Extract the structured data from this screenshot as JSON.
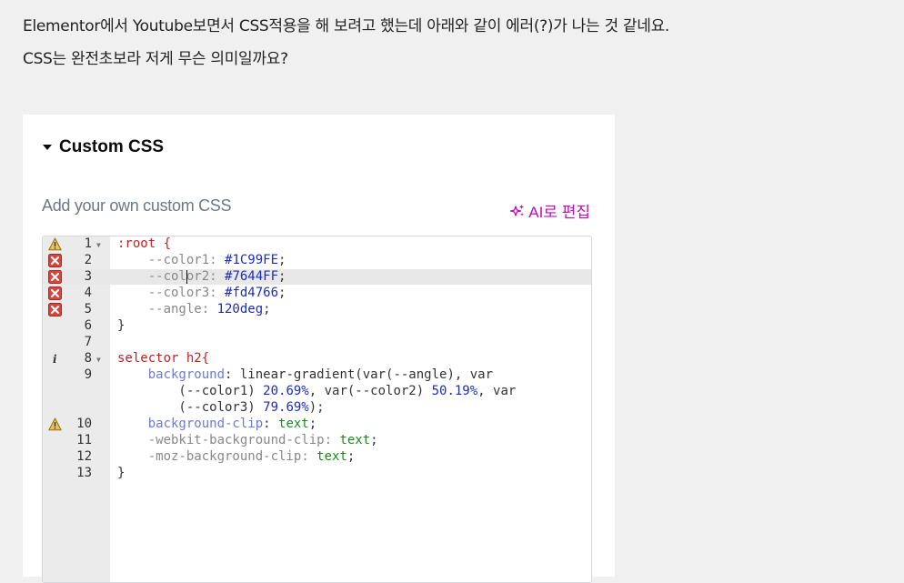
{
  "question": {
    "line1": "Elementor에서 Youtube보면서 CSS적용을 해 보려고 했는데 아래와 같이 에러(?)가 나는 것 같네요.",
    "line2": "CSS는 완전초보라 저게 무슨 의미일까요?"
  },
  "panel": {
    "section_title": "Custom CSS",
    "description": "Add your own custom CSS",
    "ai_button_label": "AI로 편집",
    "ai_icon": "sparkle-icon"
  },
  "editor": {
    "active_line": 3,
    "lines": [
      {
        "n": "1",
        "fold": true,
        "marker": "warning"
      },
      {
        "n": "2",
        "marker": "error"
      },
      {
        "n": "3",
        "marker": "error"
      },
      {
        "n": "4",
        "marker": "error"
      },
      {
        "n": "5",
        "marker": "error"
      },
      {
        "n": "6"
      },
      {
        "n": "7"
      },
      {
        "n": "8",
        "fold": true,
        "marker": "info"
      },
      {
        "n": "9"
      },
      {
        "n": ""
      },
      {
        "n": ""
      },
      {
        "n": "10",
        "marker": "warning"
      },
      {
        "n": "11"
      },
      {
        "n": "12"
      },
      {
        "n": "13"
      }
    ],
    "code": {
      "l1": ":root {",
      "l2a": "    --color1: ",
      "l2b": "#1C99FE",
      "l3a": "    --col",
      "l3b": "or2: ",
      "l3c": "#7644FF",
      "l4a": "    --color3: ",
      "l4b": "#fd4766",
      "l5a": "    --angle: ",
      "l5b": "120deg",
      "l6": "}",
      "l8": "selector h2{",
      "l9a": "    ",
      "l9b": "background",
      "l9c": ": linear-gradient(var(--angle), var",
      "l9d": "        (--color1) ",
      "l9e": "20.69%",
      "l9f": ", var(--color2) ",
      "l9g": "50.19%",
      "l9h": ", var",
      "l9i": "        (--color3) ",
      "l9j": "79.69%",
      "l9k": ");",
      "l10a": "    ",
      "l10b": "background-clip",
      "l10c": ": ",
      "l10d": "text",
      "l11a": "    -webkit-background-clip: ",
      "l11b": "text",
      "l12a": "    -moz-background-clip: ",
      "l12b": "text",
      "l13": "}",
      "semi": ";"
    }
  }
}
